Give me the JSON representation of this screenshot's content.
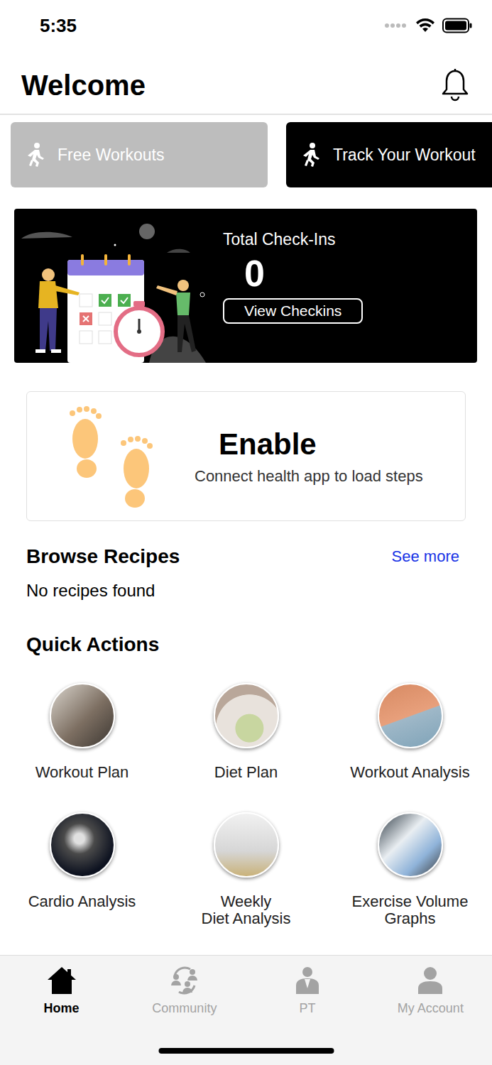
{
  "status_bar": {
    "time": "5:35"
  },
  "header": {
    "title": "Welcome"
  },
  "workout_buttons": [
    {
      "label": "Free Workouts",
      "selected": false
    },
    {
      "label": "Track Your Workout",
      "selected": true
    }
  ],
  "checkins": {
    "title": "Total Check-Ins",
    "count": "0",
    "button": "View Checkins"
  },
  "steps": {
    "title": "Enable",
    "subtitle": "Connect health app to load steps"
  },
  "recipes": {
    "title": "Browse Recipes",
    "link": "See more",
    "empty": "No recipes found"
  },
  "quick_actions": {
    "title": "Quick Actions",
    "items": [
      {
        "label": "Workout Plan"
      },
      {
        "label": "Diet Plan"
      },
      {
        "label": "Workout Analysis"
      },
      {
        "label": "Cardio Analysis"
      },
      {
        "label": "Weekly\nDiet Analysis"
      },
      {
        "label": "Exercise Volume\nGraphs"
      }
    ]
  },
  "tabs": [
    {
      "label": "Home",
      "selected": true
    },
    {
      "label": "Community",
      "selected": false
    },
    {
      "label": "PT",
      "selected": false
    },
    {
      "label": "My Account",
      "selected": false
    }
  ]
}
